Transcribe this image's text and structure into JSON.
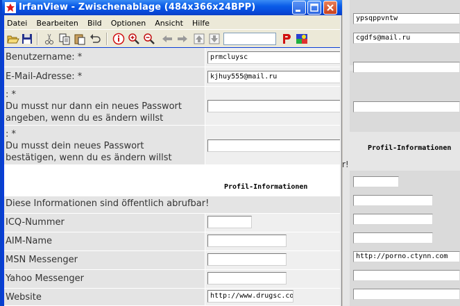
{
  "window": {
    "title": "IrfanView - Zwischenablage (484x366x24BPP)"
  },
  "menu": [
    "Datei",
    "Bearbeiten",
    "Bild",
    "Optionen",
    "Ansicht",
    "Hilfe"
  ],
  "toolbar_icons": [
    "open-folder-icon",
    "save-icon",
    "cut-icon",
    "copy-icon",
    "paste-icon",
    "undo-icon",
    "info-icon",
    "zoom-in-icon",
    "zoom-out-icon",
    "back-icon",
    "forward-icon",
    "page-up-icon",
    "page-down-icon",
    "print-icon",
    "paint-icon"
  ],
  "form": {
    "username_label": "Benutzername: *",
    "username_value": "prmcluysc",
    "email_label": "E-Mail-Adresse: *",
    "email_value": "kjhuy555@mail.ru",
    "password_label": ": *\nDu musst nur dann ein neues Passwort\nangeben, wenn du es ändern willst",
    "password_value": "",
    "confirm_label": ": *\nDu musst dein neues Passwort\nbestätigen, wenn du es ändern willst",
    "confirm_value": "",
    "profile_heading": "Profil-Informationen",
    "profile_note": "Diese Informationen sind öffentlich abrufbar!",
    "icq_label": "ICQ-Nummer",
    "icq_value": "",
    "aim_label": "AIM-Name",
    "aim_value": "",
    "msn_label": "MSN Messenger",
    "msn_value": "",
    "yahoo_label": "Yahoo Messenger",
    "yahoo_value": "",
    "website_label": "Website",
    "website_value": "http://www.drugsc.com"
  },
  "background_page": {
    "field1": "ypsqppvntw",
    "field2": "cgdfs@mail.ru",
    "heading": "Profil-Informationen",
    "fragment": "r!",
    "msn_value": "http://porno.ctynn.com"
  }
}
